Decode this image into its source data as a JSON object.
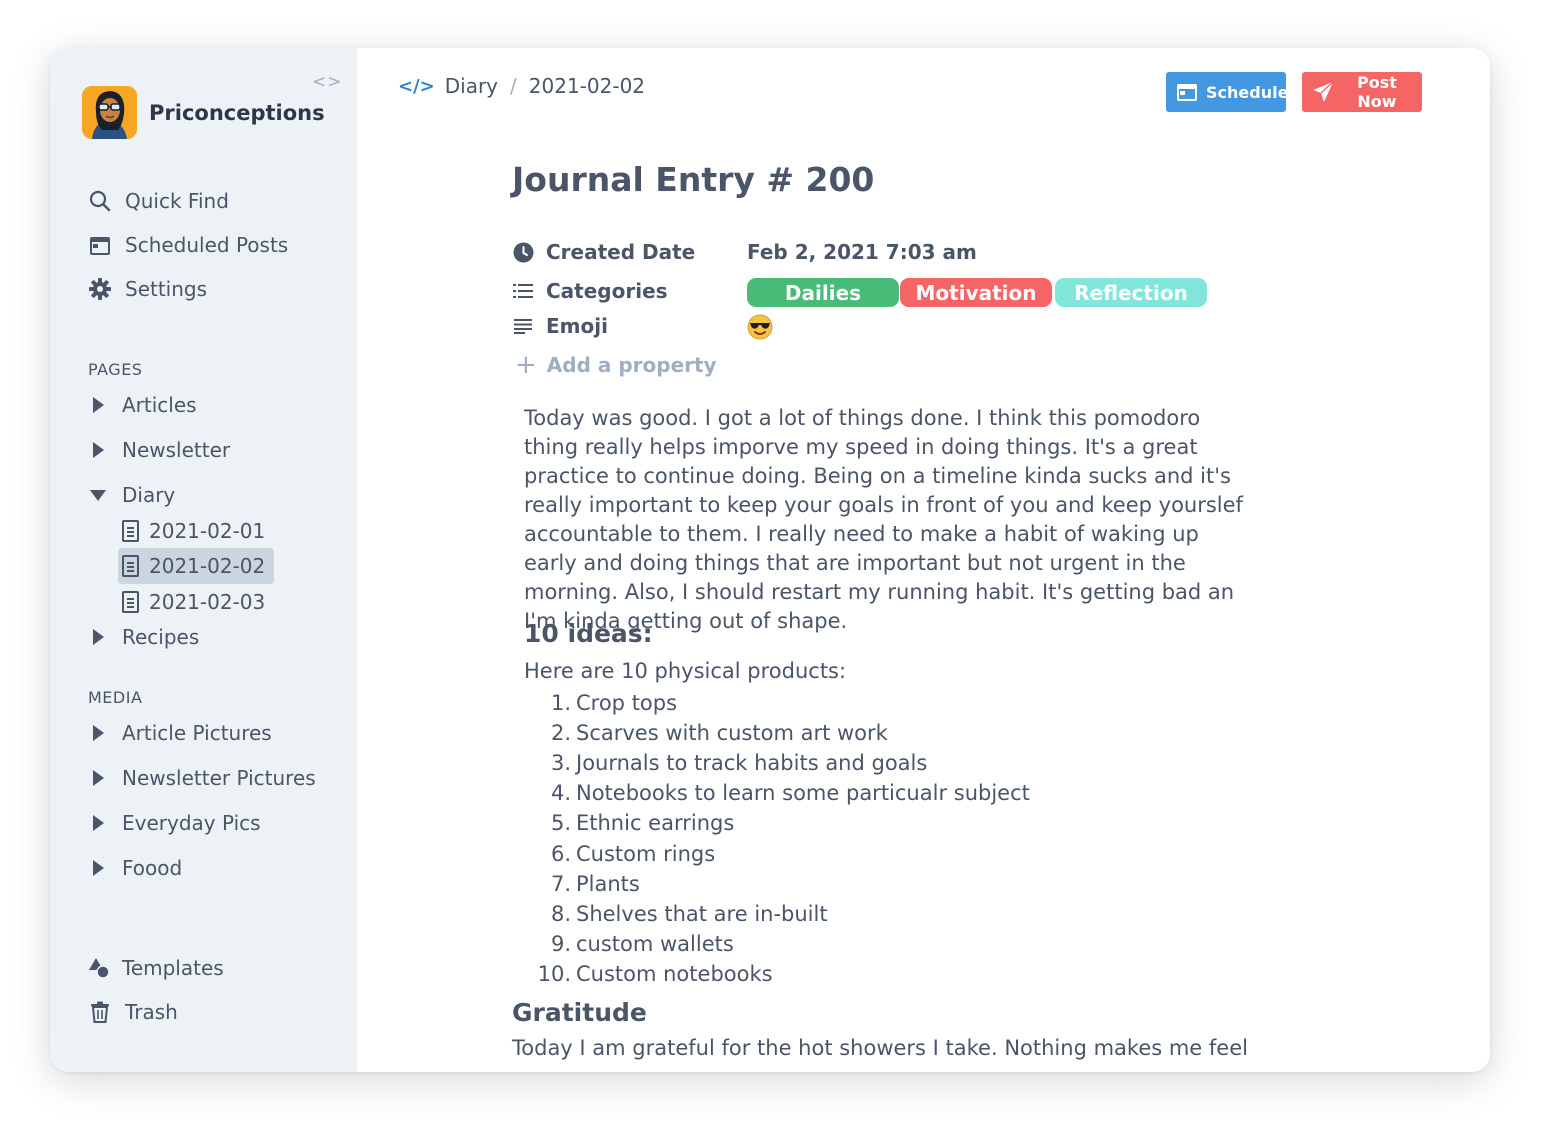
{
  "sidebar": {
    "workspace_name": "Priconceptions",
    "collapse_glyph": "<>",
    "nav": [
      {
        "label": "Quick Find",
        "icon": "search-icon"
      },
      {
        "label": "Scheduled Posts",
        "icon": "calendar-icon"
      },
      {
        "label": "Settings",
        "icon": "gear-icon"
      }
    ],
    "pages_label": "PAGES",
    "pages": [
      {
        "label": "Articles",
        "expanded": false
      },
      {
        "label": "Newsletter",
        "expanded": false
      },
      {
        "label": "Diary",
        "expanded": true
      },
      {
        "label": "Recipes",
        "expanded": false
      }
    ],
    "diary_children": [
      {
        "label": "2021-02-01",
        "active": false
      },
      {
        "label": "2021-02-02",
        "active": true
      },
      {
        "label": "2021-02-03",
        "active": false
      }
    ],
    "media_label": "MEDIA",
    "media": [
      {
        "label": "Article Pictures"
      },
      {
        "label": "Newsletter Pictures"
      },
      {
        "label": "Everyday Pics"
      },
      {
        "label": "Foood"
      }
    ],
    "footer": [
      {
        "label": "Templates",
        "icon": "shapes-icon"
      },
      {
        "label": "Trash",
        "icon": "trash-icon"
      }
    ]
  },
  "header": {
    "breadcrumb": [
      "Diary",
      "2021-02-02"
    ],
    "schedule_label": "Schedule",
    "post_now_label": "Post Now"
  },
  "document": {
    "title": "Journal Entry # 200",
    "properties": {
      "created_label": "Created Date",
      "created_value": "Feb 2, 2021 7:03 am",
      "categories_label": "Categories",
      "categories": [
        {
          "label": "Dailies",
          "color": "#48bb78"
        },
        {
          "label": "Motivation",
          "color": "#f56565"
        },
        {
          "label": "Reflection",
          "color": "#81e6d9"
        }
      ],
      "emoji_label": "Emoji",
      "emoji_value": "😎",
      "add_property_label": "Add a property"
    },
    "paragraph": "Today was good. I got a lot of things done. I think this pomodoro thing really helps imporve my speed in doing things. It's a great practice to continue doing. Being on a timeline kinda sucks and it's really important to keep your goals in front of you and keep yourslef accountable to them. I really need to make a habit of waking up early and doing things that are important but not urgent in the morning. Also, I should restart my running habit. It's getting bad an I'm kinda getting out of shape.",
    "ideas_heading": "10 ideas:",
    "ideas_intro": "Here are 10 physical products:",
    "ideas": [
      {
        "num": "1.",
        "text": "Crop tops"
      },
      {
        "num": "2.",
        "text": "Scarves with custom art work"
      },
      {
        "num": "3.",
        "text": "Journals to track habits and goals"
      },
      {
        "num": "4.",
        "text": "Notebooks to learn some particualr subject"
      },
      {
        "num": "5.",
        "text": "Ethnic earrings"
      },
      {
        "num": "6.",
        "text": "Custom rings"
      },
      {
        "num": "7.",
        "text": "Plants"
      },
      {
        "num": "8.",
        "text": "Shelves that are in-built"
      },
      {
        "num": "9.",
        "text": "custom wallets"
      },
      {
        "num": "10.",
        "text": "Custom notebooks"
      }
    ],
    "gratitude_heading": "Gratitude",
    "gratitude_text": "Today I am grateful for the hot showers I take. Nothing makes me feel"
  },
  "colors": {
    "sidebar_bg": "#edf2f7",
    "active_item_bg": "#cbd5e0",
    "schedule_button": "#4299e1",
    "post_button": "#f56565",
    "text": "#4a5568"
  }
}
